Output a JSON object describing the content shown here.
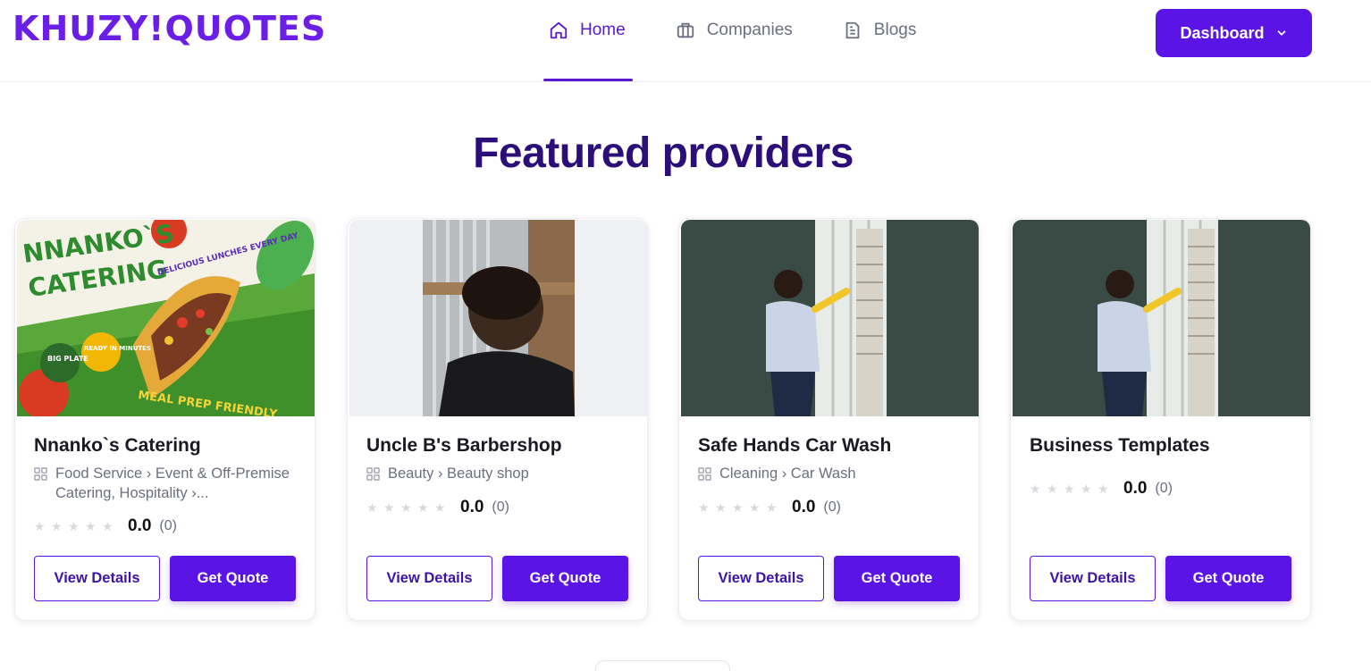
{
  "brand": {
    "logo_text": "KHUZY!QUOTES",
    "accent": "#5b14e6",
    "title_color": "#2c0e79"
  },
  "nav": {
    "items": [
      {
        "label": "Home",
        "icon": "home-icon",
        "active": true
      },
      {
        "label": "Companies",
        "icon": "briefcase-icon",
        "active": false
      },
      {
        "label": "Blogs",
        "icon": "document-icon",
        "active": false
      }
    ],
    "dashboard_label": "Dashboard"
  },
  "section": {
    "title": "Featured providers"
  },
  "providers": [
    {
      "name": "Nnanko`s Catering",
      "category": "Food Service › Event & Off-Premise Catering, Hospitality ›...",
      "rating": "0.0",
      "reviews": "(0)",
      "image": "catering-taco-flyer",
      "image_text": {
        "headline": "NNANKO`S CATERING",
        "tagline": "DELICIOUS LUNCHES EVERY DAY",
        "badge1": "BIG PLATE",
        "badge2": "READY IN MINUTES",
        "footer": "MEAL PREP FRIENDLY"
      },
      "view_label": "View Details",
      "quote_label": "Get Quote"
    },
    {
      "name": "Uncle B's Barbershop",
      "category": "Beauty › Beauty shop",
      "rating": "0.0",
      "reviews": "(0)",
      "image": "barbershop-haircut-photo",
      "view_label": "View Details",
      "quote_label": "Get Quote"
    },
    {
      "name": "Safe Hands Car Wash",
      "category": "Cleaning › Car Wash",
      "rating": "0.0",
      "reviews": "(0)",
      "image": "window-cleaning-photo",
      "view_label": "View Details",
      "quote_label": "Get Quote"
    },
    {
      "name": "Business Templates",
      "category": "",
      "rating": "0.0",
      "reviews": "(0)",
      "image": "window-cleaning-photo",
      "view_label": "View Details",
      "quote_label": "Get Quote"
    }
  ]
}
